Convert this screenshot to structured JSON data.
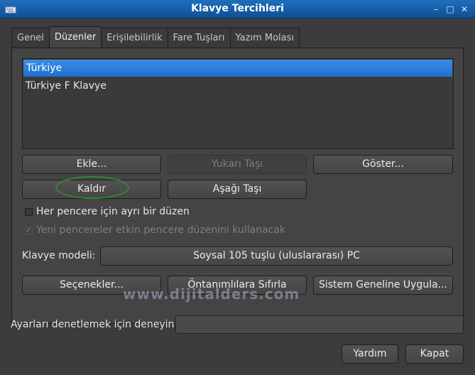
{
  "window": {
    "title": "Klavye Tercihleri",
    "controls": [
      "–",
      "□",
      "✕"
    ]
  },
  "tabs": [
    "Genel",
    "Düzenler",
    "Erişilebilirlik",
    "Fare Tuşları",
    "Yazım Molası"
  ],
  "active_tab": "Düzenler",
  "layouts": {
    "items": [
      "Türkiye",
      "Türkiye F Klavye"
    ],
    "selected": "Türkiye"
  },
  "buttons": {
    "add": "Ekle...",
    "move_up": "Yukarı Taşı",
    "show": "Göster...",
    "remove": "Kaldır",
    "move_down": "Aşağı Taşı",
    "options": "Seçenekler...",
    "reset_defaults": "Öntanımlılara Sıfırla",
    "apply_system": "Sistem Geneline Uygula...",
    "help": "Yardım",
    "close": "Kapat"
  },
  "checkboxes": {
    "separate_layout": {
      "label": "Her pencere için ayrı bir düzen",
      "checked": false
    },
    "new_windows": {
      "label": "Yeni pencereler etkin pencere düzenini kullanacak",
      "checked": true
    }
  },
  "keyboard_model": {
    "label": "Klavye modeli:",
    "value": "Soysal 105 tuşlu (uluslararası) PC"
  },
  "test_field": {
    "label": "Ayarları denetlemek için deneyin:",
    "value": ""
  },
  "watermark": "www.dijitalders.com"
}
